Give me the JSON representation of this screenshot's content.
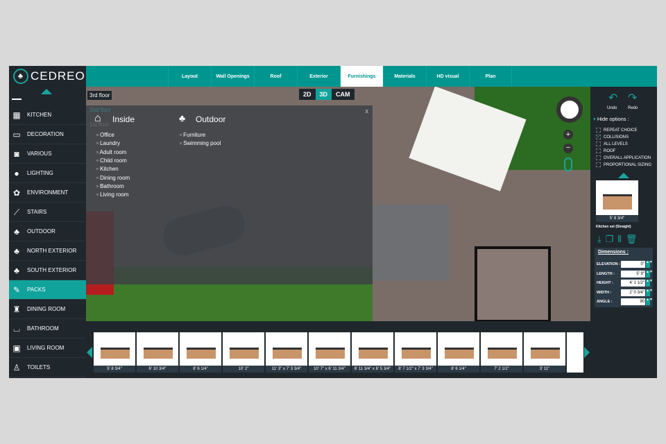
{
  "brand": "CEDREO",
  "tabs": [
    "Layout",
    "Wall Openings",
    "Roof",
    "Exterior",
    "Furnishings",
    "Materials",
    "HD visual",
    "Plan"
  ],
  "active_tab": "Furnishings",
  "sidebar": [
    "KITCHEN",
    "DECORATION",
    "VARIOUS",
    "LIGHTING",
    "ENVIRONMENT",
    "STAIRS",
    "OUTDOOR",
    "NORTH EXTERIOR",
    "SOUTH EXTERIOR",
    "PACKS",
    "DINING ROOM",
    "BATHROOM",
    "LIVING ROOM",
    "TOILETS"
  ],
  "active_sidebar": "PACKS",
  "floors": [
    "3rd floor",
    "2nd floor",
    "1st floor"
  ],
  "view_modes": [
    "2D",
    "3D",
    "CAM"
  ],
  "overlay": {
    "close": "x",
    "inside_title": "Inside",
    "outdoor_title": "Outdoor",
    "inside": [
      "Office",
      "Laundry",
      "Adult room",
      "Child room",
      "Kitchen",
      "Dining room",
      "Bathroom",
      "Living room"
    ],
    "outdoor": [
      "Furniture",
      "Swimming pool"
    ]
  },
  "right": {
    "undo": "Undo",
    "redo": "Redo",
    "hide_options": "Hide options :",
    "options": [
      {
        "label": "REPEAT CHOICE",
        "checked": false
      },
      {
        "label": "COLLISIONS",
        "checked": true
      },
      {
        "label": "ALL LEVELS",
        "checked": false
      },
      {
        "label": "ROOF",
        "checked": false
      },
      {
        "label": "OVERALL APPLICATION",
        "checked": false
      },
      {
        "label": "PROPORTIONAL SIZING",
        "checked": false
      }
    ],
    "selected_size": "5' 8 3/4\"",
    "selected_name": "Kitchen set (Straight)",
    "dimensions_title": "Dimensions :",
    "dimensions": [
      {
        "label": "ELEVATION :",
        "value": "0\""
      },
      {
        "label": "LENGTH :",
        "value": "5' 9\""
      },
      {
        "label": "HEIGHT :",
        "value": "4' 1 1/2\""
      },
      {
        "label": "WIDTH :",
        "value": "2' 0 3/4\""
      },
      {
        "label": "ANGLE :",
        "value": "90"
      }
    ]
  },
  "thumbnails": [
    "5' 8 3/4\"",
    "6' 10 3/4\"",
    "8' 6 1/4\"",
    "10' 2\"",
    "11' 3\" x 7' 3 3/4\"",
    "10' 7\" x 6' 11 3/4\"",
    "6' 11 3/4\" x 6' 5 3/4\"",
    "8' 7 1/2\" x 7' 3 3/4\"",
    "8' 6 1/4\"",
    "7' 2 1/2\"",
    "3' 11\""
  ]
}
